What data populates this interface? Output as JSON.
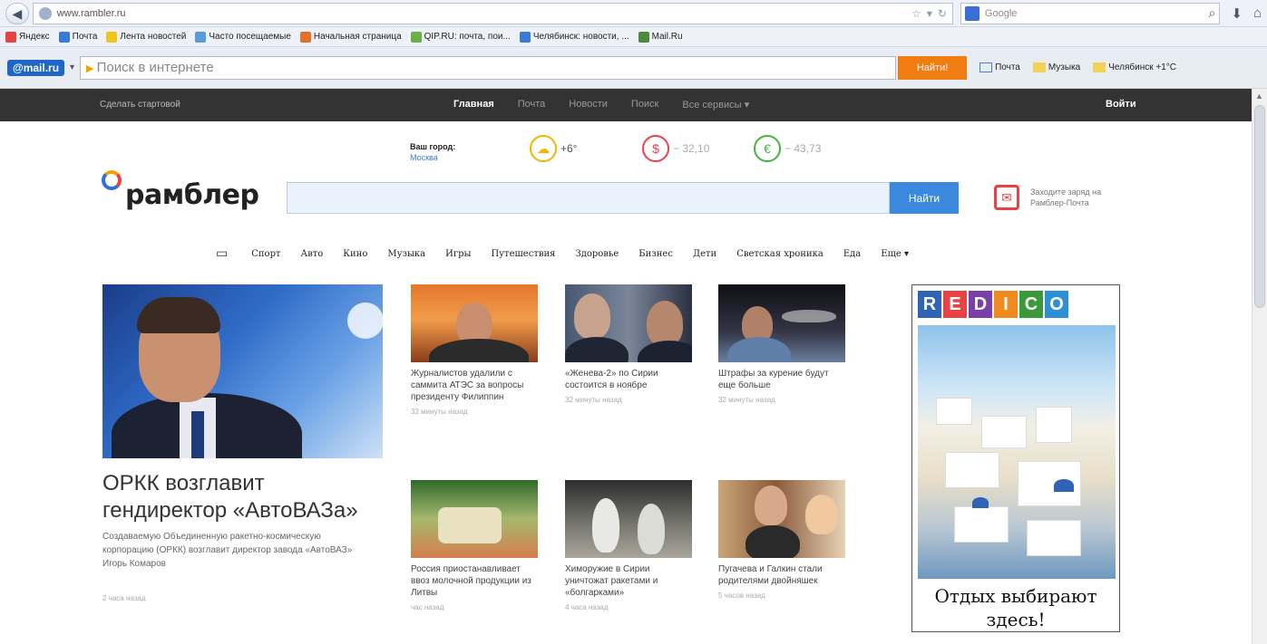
{
  "browser": {
    "url": "www.rambler.ru",
    "search_engine": "Google",
    "bookmarks": [
      "Яндекс",
      "Почта",
      "Лента новостей",
      "Часто посещаемые",
      "Начальная страница",
      "QIP.RU: почта, пои...",
      "Челябинск: новости, ...",
      "Mail.Ru"
    ],
    "bookmark_colors": [
      "#e84242",
      "#3a7bd5",
      "#f0c419",
      "#5a9bd5",
      "#e0702a",
      "#68b244",
      "#3a7bd5",
      "#4a8a3a"
    ]
  },
  "mailru_toolbar": {
    "logo": "@mail.ru",
    "search_placeholder": "Поиск в интернете",
    "find_label": "Найти!",
    "mail_link": "Почта",
    "music_link": "Музыка",
    "weather_link": "Челябинск +1°C"
  },
  "rambler": {
    "topbar": {
      "make_start": "Сделать стартовой",
      "menu": [
        "Главная",
        "Почта",
        "Новости",
        "Поиск",
        "Все сервисы ▾"
      ],
      "login": "Войти"
    },
    "city": {
      "label": "Ваш город:",
      "name": "Москва"
    },
    "weather": {
      "value": "+6°",
      "icon": "sun-cloud-icon"
    },
    "usd": {
      "value": "− 32,10",
      "symbol": "$"
    },
    "eur": {
      "value": "− 43,73",
      "symbol": "€"
    },
    "logo_text": "рамблер",
    "search_button": "Найти",
    "mail_promo": "Заходите заряд на Рамблер-Почта",
    "categories": [
      "Спорт",
      "Авто",
      "Кино",
      "Музыка",
      "Игры",
      "Путешествия",
      "Здоровье",
      "Бизнес",
      "Дети",
      "Светская хроника",
      "Еда",
      "Еще ▾"
    ],
    "featured": {
      "title": "ОРКК возглавит гендиректор «АвтоВАЗа»",
      "description": "Создаваемую Объединенную ракетно-космическую корпорацию (ОРКК) возглавит директор завода «АвтоВАЗ» Игорь Комаров",
      "time": "2 часа назад"
    },
    "news": [
      {
        "title": "Журналистов удалили с саммита АТЭС за вопросы президенту Филиппин",
        "time": "32 минуты назад"
      },
      {
        "title": "«Женева-2» по Сирии состоится в ноябре",
        "time": "32 минуты назад"
      },
      {
        "title": "Штрафы за курение будут еще больше",
        "time": "32 минуты назад"
      },
      {
        "title": "Россия приостанавливает ввоз молочной продукции из Литвы",
        "time": "час назад"
      },
      {
        "title": "Химоружие в Сирии уничтожат ракетами и «болгарками»",
        "time": "4 часа назад"
      },
      {
        "title": "Пугачева и Галкин стали родителями двойняшек",
        "time": "5 часов назад"
      }
    ],
    "ad": {
      "letters": [
        "R",
        "E",
        "D",
        "I",
        "C",
        "O"
      ],
      "letter_colors": [
        "#2e63b5",
        "#e84242",
        "#7a3fa8",
        "#f08a1f",
        "#3a9a3a",
        "#2e8fd5"
      ],
      "slogan": "Отдых выбирают здесь!"
    }
  }
}
